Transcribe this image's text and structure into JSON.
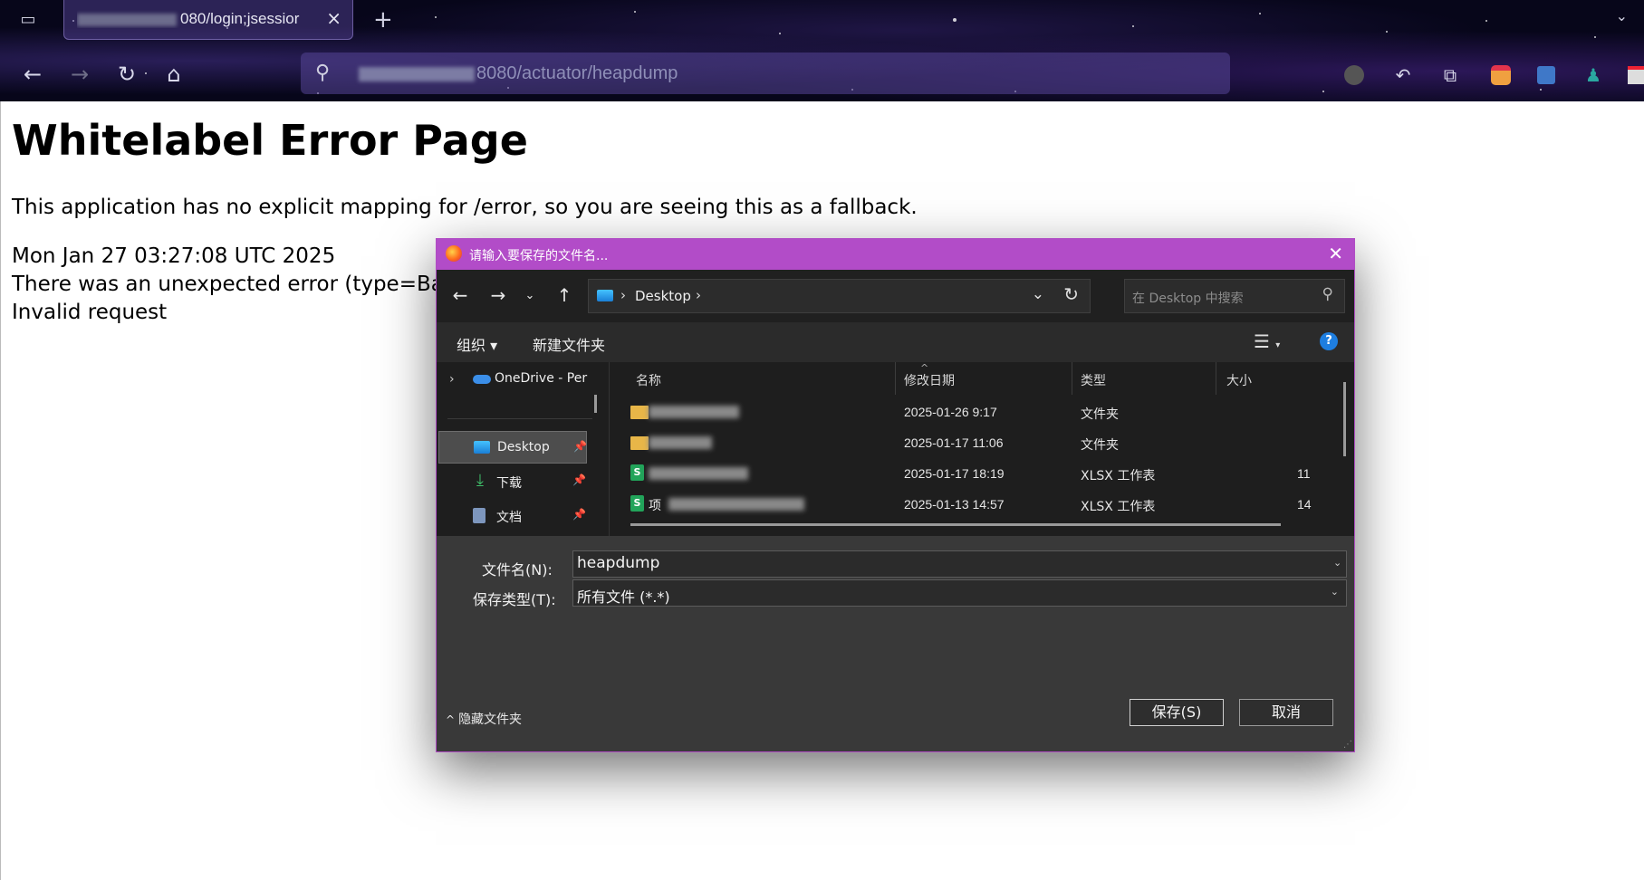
{
  "browser": {
    "tab": {
      "title_visible_suffix": "080/login;jsessior",
      "close_label": "×"
    },
    "new_tab_label": "+",
    "url": {
      "visible_suffix": "8080/actuator/heapdump"
    }
  },
  "page": {
    "title": "Whitelabel Error Page",
    "line1": "This application has no explicit mapping for /error, so you are seeing this as a fallback.",
    "line2": "Mon Jan 27 03:27:08 UTC 2025",
    "line3": "There was an unexpected error (type=Bad",
    "line4": "Invalid request"
  },
  "dialog": {
    "title": "请输入要保存的文件名...",
    "breadcrumb": {
      "sep": "›",
      "item": "Desktop"
    },
    "search_placeholder": "在 Desktop 中搜索",
    "toolbar": {
      "organize": "组织 ▾",
      "new_folder": "新建文件夹",
      "help": "?"
    },
    "nav_pane": {
      "onedrive": "OneDrive - Per",
      "items": [
        {
          "label": "Desktop",
          "pinned": true,
          "selected": true
        },
        {
          "label": "下载",
          "pinned": true,
          "selected": false
        },
        {
          "label": "文档",
          "pinned": true,
          "selected": false
        }
      ]
    },
    "columns": {
      "name": "名称",
      "modified": "修改日期",
      "type": "类型",
      "size": "大小"
    },
    "files": [
      {
        "icon": "folder-icon",
        "name": "",
        "modified": "2025-01-26 9:17",
        "type": "文件夹",
        "size": ""
      },
      {
        "icon": "folder-icon",
        "name": "",
        "modified": "2025-01-17 11:06",
        "type": "文件夹",
        "size": ""
      },
      {
        "icon": "xlsx-icon",
        "name": "",
        "modified": "2025-01-17 18:19",
        "type": "XLSX 工作表",
        "size": "11"
      },
      {
        "icon": "xlsx-icon",
        "name": "项",
        "modified": "2025-01-13 14:57",
        "type": "XLSX 工作表",
        "size": "14"
      }
    ],
    "filename_label": "文件名(N):",
    "filename_value": "heapdump",
    "filetype_label": "保存类型(T):",
    "filetype_value": "所有文件 (*.*)",
    "hide_folders": "隐藏文件夹",
    "save_button": "保存(S)",
    "cancel_button": "取消"
  }
}
